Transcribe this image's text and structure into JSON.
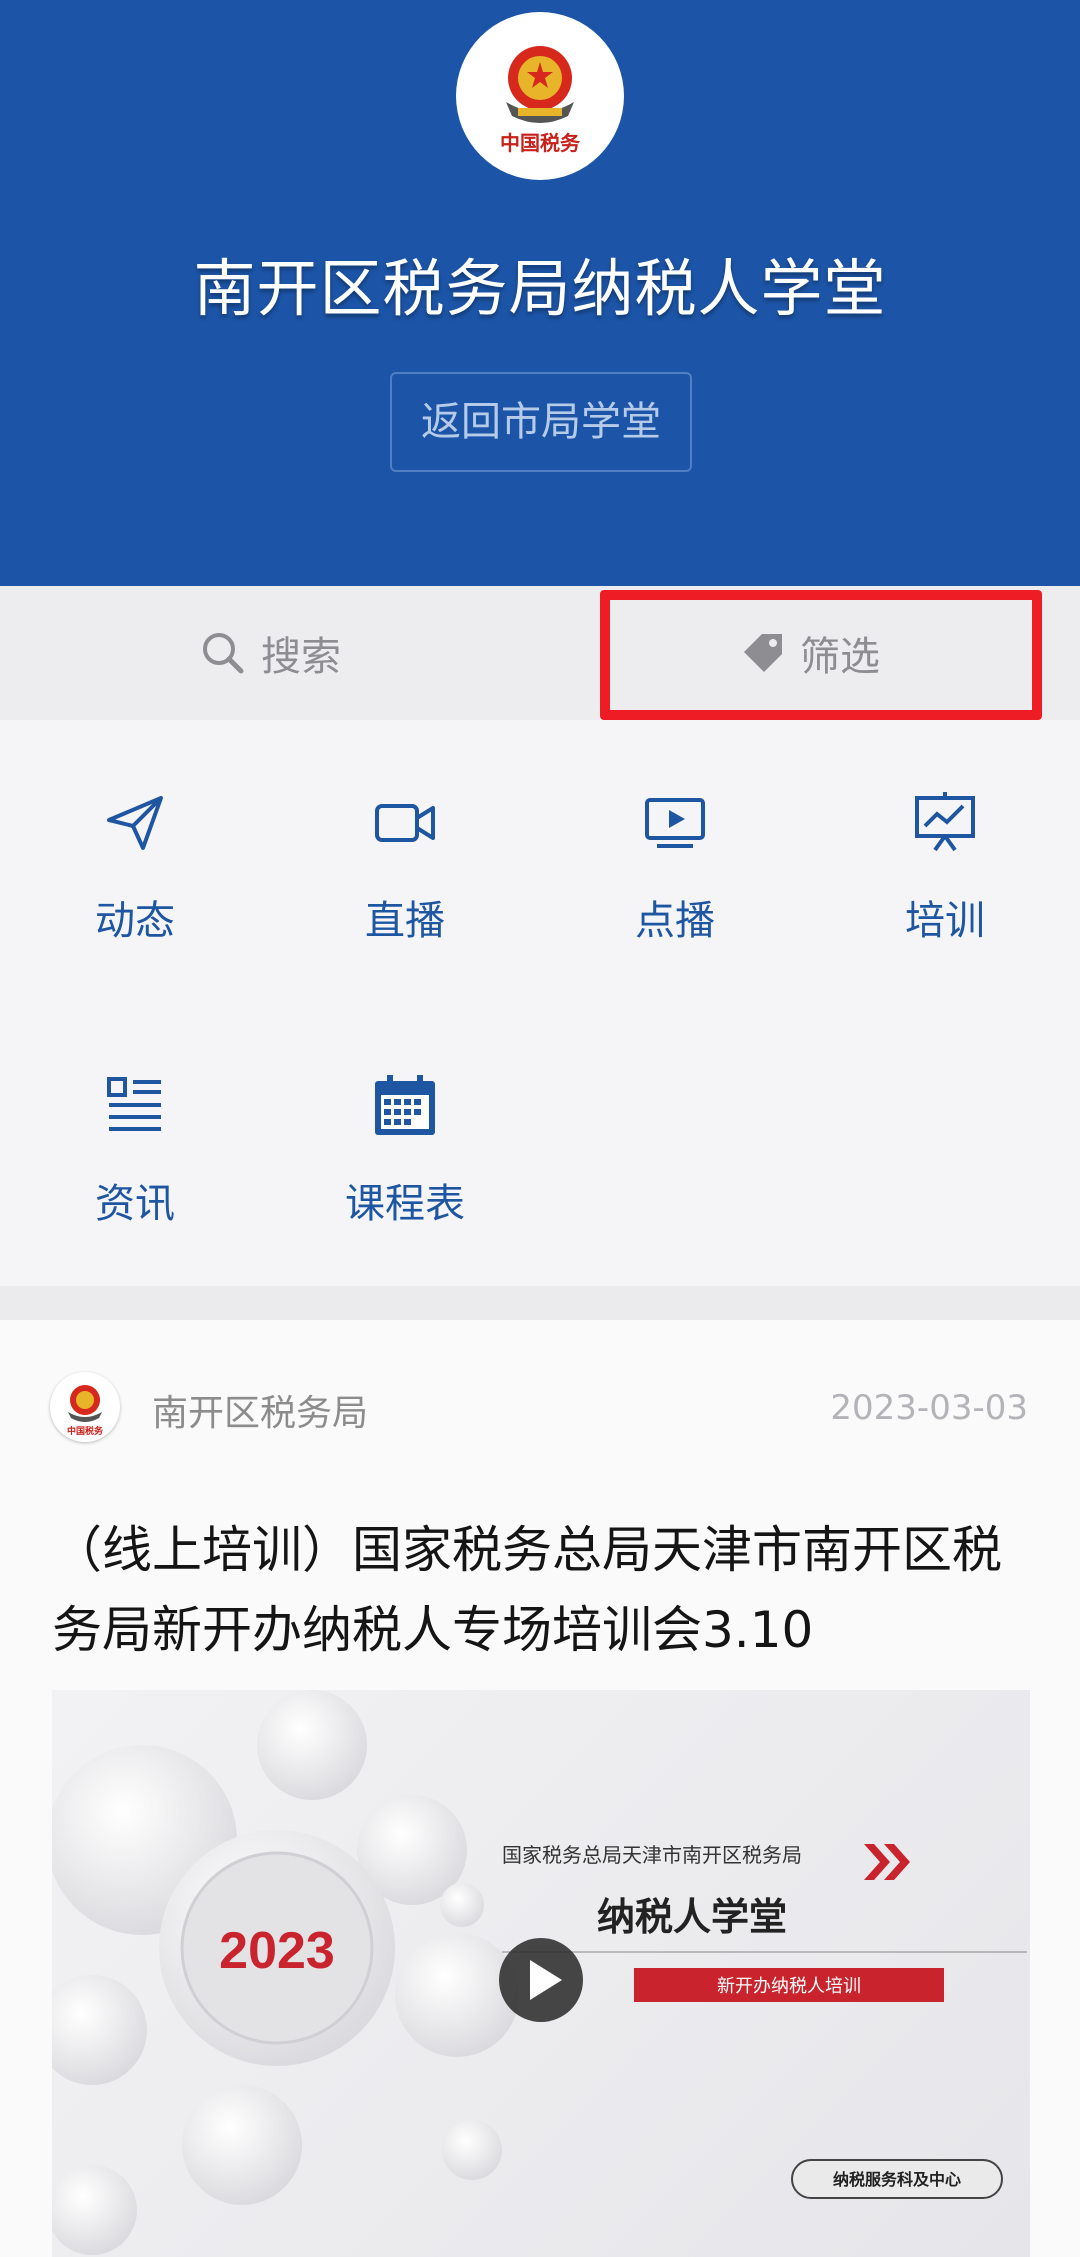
{
  "header": {
    "logo_text": "中国税务",
    "title": "南开区税务局纳税人学堂",
    "back_button": "返回市局学堂"
  },
  "toolbar": {
    "search_label": "搜索",
    "filter_label": "筛选"
  },
  "grid": [
    {
      "label": "动态",
      "icon": "paper-plane-icon"
    },
    {
      "label": "直播",
      "icon": "video-camera-icon"
    },
    {
      "label": "点播",
      "icon": "play-screen-icon"
    },
    {
      "label": "培训",
      "icon": "presentation-board-icon"
    },
    {
      "label": "资讯",
      "icon": "news-list-icon"
    },
    {
      "label": "课程表",
      "icon": "calendar-icon"
    }
  ],
  "post": {
    "author": "南开区税务局",
    "date": "2023-03-03",
    "title": "（线上培训）国家税务总局天津市南开区税务局新开办纳税人专场培训会3.10",
    "thumbnail": {
      "year": "2023",
      "org": "国家税务总局天津市南开区税务局",
      "headline": "纳税人学堂",
      "subtitle": "新开办纳税人培训",
      "footer": "纳税服务科及中心"
    }
  },
  "colors": {
    "header_bg": "#1c55a8",
    "accent": "#1f56a2",
    "highlight": "#ee1c25"
  }
}
